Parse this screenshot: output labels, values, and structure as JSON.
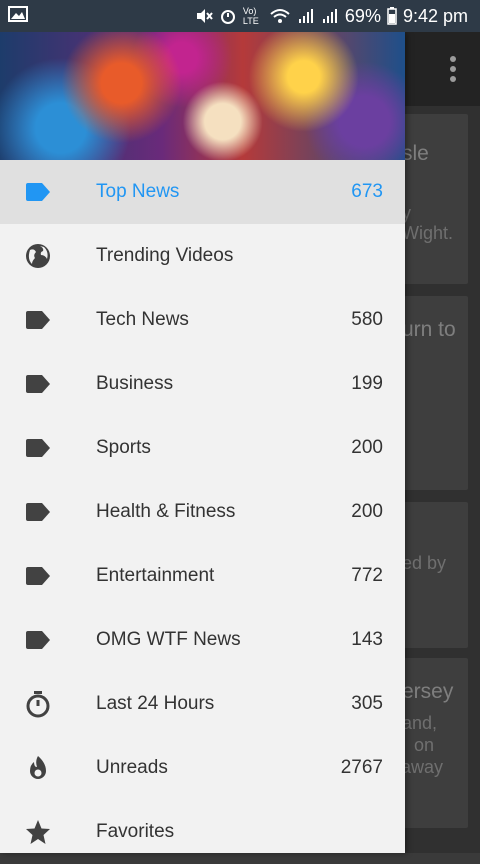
{
  "status_bar": {
    "battery": "69%",
    "time": "9:42 pm",
    "network_label": "Vo) LTE"
  },
  "drawer": {
    "items": [
      {
        "label": "Top News",
        "count": "673",
        "icon": "label-tag-icon",
        "active": true
      },
      {
        "label": "Trending Videos",
        "count": "",
        "icon": "globe-icon",
        "active": false
      },
      {
        "label": "Tech News",
        "count": "580",
        "icon": "label-tag-icon",
        "active": false
      },
      {
        "label": "Business",
        "count": "199",
        "icon": "label-tag-icon",
        "active": false
      },
      {
        "label": "Sports",
        "count": "200",
        "icon": "label-tag-icon",
        "active": false
      },
      {
        "label": "Health & Fitness",
        "count": "200",
        "icon": "label-tag-icon",
        "active": false
      },
      {
        "label": "Entertainment",
        "count": "772",
        "icon": "label-tag-icon",
        "active": false
      },
      {
        "label": "OMG WTF News",
        "count": "143",
        "icon": "label-tag-icon",
        "active": false
      },
      {
        "label": "Last 24 Hours",
        "count": "305",
        "icon": "stopwatch-icon",
        "active": false
      },
      {
        "label": "Unreads",
        "count": "2767",
        "icon": "flame-icon",
        "active": false
      },
      {
        "label": "Favorites",
        "count": "",
        "icon": "star-icon",
        "active": false
      }
    ],
    "accent_color": "#2196f3"
  },
  "background_cards": [
    {
      "title": "sle",
      "body": [
        "y",
        "Wight."
      ]
    },
    {
      "title": "urn to",
      "body": []
    },
    {
      "title": "",
      "body": [
        "ed by"
      ]
    },
    {
      "title": "ersey",
      "body": [
        "and,",
        "on",
        "r away"
      ]
    }
  ]
}
